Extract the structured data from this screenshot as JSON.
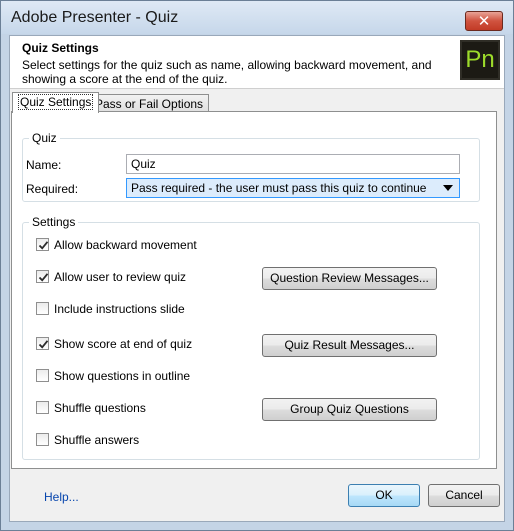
{
  "window": {
    "title": "Adobe Presenter - Quiz",
    "close_symbol": "✕"
  },
  "header": {
    "title": "Quiz Settings",
    "description": "Select settings for the quiz such as name, allowing backward movement, and showing a score at the end of the quiz.",
    "logo_text": "Pn"
  },
  "tabs": [
    {
      "label": "Quiz Settings",
      "active": true
    },
    {
      "label": "Pass or Fail Options",
      "active": false
    }
  ],
  "quiz_group": {
    "label": "Quiz",
    "name_label": "Name:",
    "name_value": "Quiz",
    "required_label": "Required:",
    "required_value": "Pass required - the user must pass this quiz to continue"
  },
  "settings_group": {
    "label": "Settings",
    "checkboxes": [
      {
        "label": "Allow backward movement",
        "checked": true
      },
      {
        "label": "Allow user to review quiz",
        "checked": true
      },
      {
        "label": "Include instructions slide",
        "checked": false
      },
      {
        "label": "Show score at end of quiz",
        "checked": true
      },
      {
        "label": "Show questions in outline",
        "checked": false
      },
      {
        "label": "Shuffle questions",
        "checked": false
      },
      {
        "label": "Shuffle answers",
        "checked": false
      }
    ],
    "buttons": {
      "question_review": "Question Review Messages...",
      "quiz_result": "Quiz Result Messages...",
      "group_quiz": "Group Quiz Questions"
    }
  },
  "footer": {
    "help": "Help...",
    "ok": "OK",
    "cancel": "Cancel"
  },
  "colors": {
    "accent": "#3399ff",
    "logo_text": "#9ddb2b",
    "close_button": "#c23b26"
  }
}
